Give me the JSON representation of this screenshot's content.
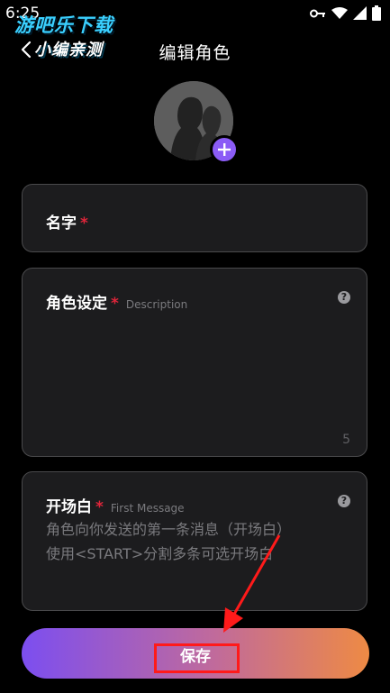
{
  "status_bar": {
    "time": "6:25"
  },
  "watermark": {
    "line1": "游吧乐下载",
    "line2": "小编亲测"
  },
  "header": {
    "title": "编辑角色"
  },
  "name_field": {
    "label": "名字",
    "required_mark": "*"
  },
  "description_field": {
    "label": "角色设定",
    "required_mark": "*",
    "hint": "Description",
    "char_count": "5"
  },
  "first_message_field": {
    "label": "开场白",
    "required_mark": "*",
    "hint": "First Message",
    "placeholder_line1": "角色向你发送的第一条消息（开场白）",
    "placeholder_line2": "使用<START>分割多条可选开场白"
  },
  "save_button": {
    "label": "保存"
  },
  "icons": {
    "back": "chevron-left-icon",
    "add": "plus-icon",
    "help": "question-circle-icon",
    "key": "key-icon",
    "wifi": "wifi-icon",
    "signal": "signal-icon",
    "battery": "battery-icon"
  },
  "colors": {
    "background": "#000000",
    "card": "#1c1c1e",
    "accent_purple": "#8b5cf6",
    "required_red": "#e0253a",
    "gradient_start": "#7c4ef0",
    "gradient_end": "#ee8a44"
  }
}
